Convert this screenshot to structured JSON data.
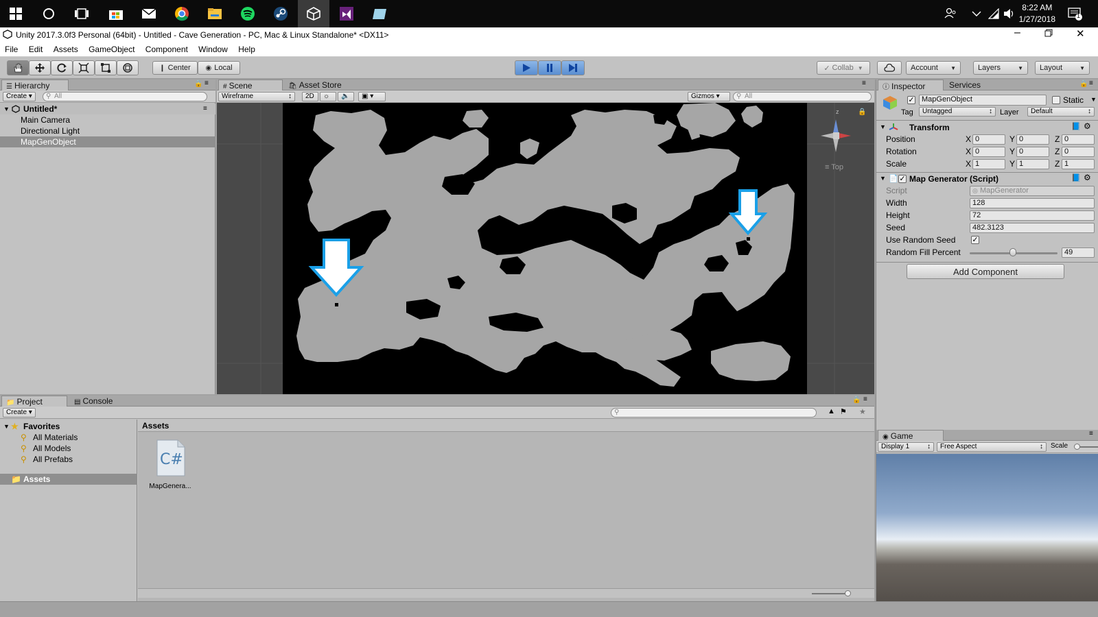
{
  "taskbar": {
    "time": "8:22 AM",
    "date": "1/27/2018",
    "notification_count": "1"
  },
  "window": {
    "title": "Unity 2017.3.0f3 Personal (64bit) - Untitled - Cave Generation - PC, Mac & Linux Standalone* <DX11>"
  },
  "menu": [
    "File",
    "Edit",
    "Assets",
    "GameObject",
    "Component",
    "Window",
    "Help"
  ],
  "toolbar": {
    "pivot_label": "Center",
    "space_label": "Local",
    "collab_label": "Collab",
    "account_label": "Account",
    "layers_label": "Layers",
    "layout_label": "Layout"
  },
  "hierarchy": {
    "tab": "Hierarchy",
    "create_label": "Create",
    "search_placeholder": "All",
    "scene_name": "Untitled*",
    "items": [
      "Main Camera",
      "Directional Light",
      "MapGenObject"
    ],
    "selected": "MapGenObject"
  },
  "scene": {
    "tab": "Scene",
    "asset_store_tab": "Asset Store",
    "draw_mode": "Wireframe",
    "mode_2d": "2D",
    "gizmos_label": "Gizmos",
    "search_placeholder": "All",
    "gizmo_axis_z": "z",
    "view_label": "Top"
  },
  "inspector": {
    "tab": "Inspector",
    "services_tab": "Services",
    "object_name": "MapGenObject",
    "static_label": "Static",
    "tag_label": "Tag",
    "tag_value": "Untagged",
    "layer_label": "Layer",
    "layer_value": "Default",
    "transform": {
      "title": "Transform",
      "position_label": "Position",
      "rotation_label": "Rotation",
      "scale_label": "Scale",
      "axis_x": "X",
      "axis_y": "Y",
      "axis_z": "Z",
      "position": [
        "0",
        "0",
        "0"
      ],
      "rotation": [
        "0",
        "0",
        "0"
      ],
      "scale": [
        "1",
        "1",
        "1"
      ]
    },
    "map_generator": {
      "title": "Map Generator (Script)",
      "script_label": "Script",
      "script_value": "MapGenerator",
      "width_label": "Width",
      "width_value": "128",
      "height_label": "Height",
      "height_value": "72",
      "seed_label": "Seed",
      "seed_value": "482.3123",
      "use_random_seed_label": "Use Random Seed",
      "use_random_seed": true,
      "fill_label": "Random Fill Percent",
      "fill_value": "49",
      "fill_min": 0,
      "fill_max": 100
    },
    "add_component_label": "Add Component"
  },
  "project": {
    "tab": "Project",
    "console_tab": "Console",
    "create_label": "Create",
    "favorites_label": "Favorites",
    "favorites": [
      "All Materials",
      "All Models",
      "All Prefabs"
    ],
    "assets_root": "Assets",
    "breadcrumb": "Assets",
    "files": [
      {
        "name": "MapGenera...",
        "type": "C#"
      }
    ]
  },
  "game": {
    "tab": "Game",
    "display_label": "Display 1",
    "aspect_label": "Free Aspect",
    "scale_label": "Scale"
  },
  "colors": {
    "accent_arrow": "#1aa0e8",
    "selected_row": "#8f8f8f",
    "cave_floor": "#a6a6a6",
    "cave_wall": "#000000"
  }
}
